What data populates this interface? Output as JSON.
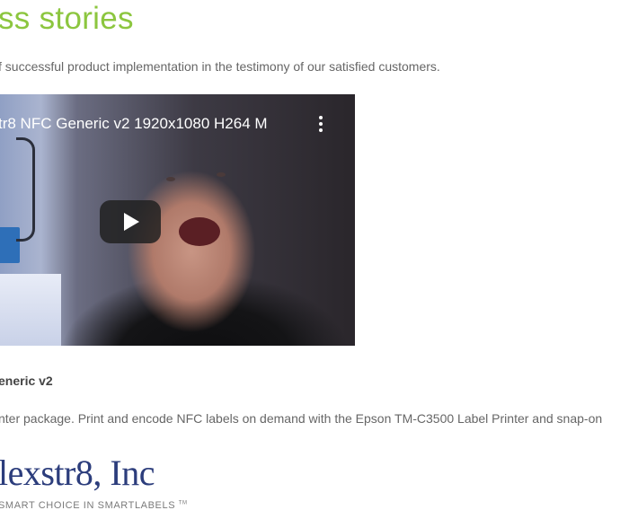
{
  "heading": "ss stories",
  "intro": "f successful product implementation in the testimony of our satisfied customers.",
  "video": {
    "title": "tr8 NFC Generic v2 1920x1080 H264 M",
    "play_icon": "play-icon",
    "menu_icon": "more-vert-icon"
  },
  "caption": {
    "title": "eneric v2",
    "description": "nter package. Print and encode NFC labels on demand with the Epson TM-C3500 Label Printer and snap-on"
  },
  "logo": {
    "name": "lexstr8, Inc",
    "tagline": "SMART CHOICE IN SMARTLABELS",
    "tm": "TM"
  },
  "colors": {
    "accent": "#8cc63f",
    "logo_blue": "#2c3d7c"
  }
}
